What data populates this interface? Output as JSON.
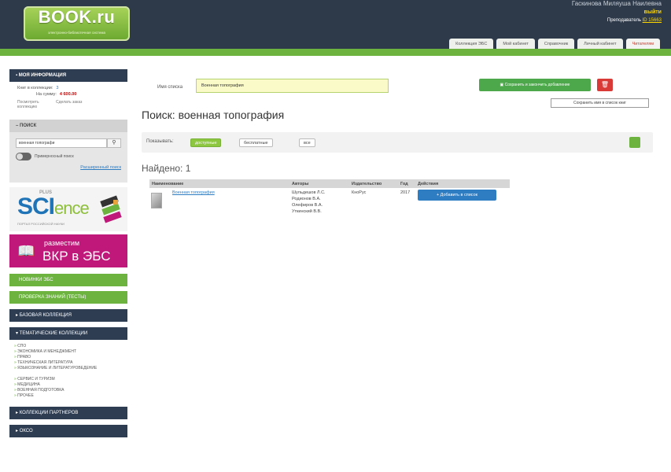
{
  "header": {
    "logo": "BOOK.ru",
    "logo_sub": "электронно-библиотечная система",
    "user_line": "Гаскинова Миляуша Наилевна",
    "login": "выйти",
    "teacher_label": "Преподаватель",
    "teacher_id": "ID 15663",
    "tabs": [
      "Коллекция ЭБС",
      "Мой кабинет",
      "Справочник",
      "Личный кабинет",
      "Читателям"
    ]
  },
  "sidebar": {
    "my_info_title": "МОЯ ИНФОРМАЦИЯ",
    "books_in_collection_label": "Книг в коллекции:",
    "books_in_collection_value": "3",
    "sum_label": "На сумму:",
    "sum_value": "4 600.00",
    "view_collection": "Посмотреть коллекцию",
    "make_order": "Сделать заказ",
    "search_title": "ПОИСК",
    "search_value": "военная топографи",
    "toggle_label": "Примерносный поиск",
    "extended_search": "Расширенный поиск",
    "science_word": "SCI",
    "science_rest": "ence",
    "science_plus": "PLUS",
    "science_caption": "ПОРТАЛ РОССИЙСКОЙ НАУКИ",
    "vkr_line1": "разместим",
    "vkr_line2": "ВКР в ЭБС",
    "new_ebs": "НОВИНКИ ЭБС",
    "knowledge_test": "ПРОВЕРКА ЗНАНИЙ (ТЕСТЫ)",
    "base_collection": "БАЗОВАЯ КОЛЛЕКЦИЯ",
    "thematic_collections": "ТЕМАТИЧЕСКИЕ КОЛЛЕКЦИИ",
    "categories": [
      "СПО",
      "ЭКОНОМИКА И МЕНЕДЖМЕНТ",
      "ПРАВО",
      "ТЕХНИЧЕСКАЯ ЛИТЕРАТУРА",
      "ЯЗЫКОЗНАНИЕ И ЛИТЕРАТУРОВЕДЕНИЕ",
      "СЕРВИС И ТУРИЗМ",
      "МЕДИЦИНА",
      "ВОЕННАЯ ПОДГОТОВКА",
      "ПРОЧЕЕ"
    ],
    "partner_collections": "КОЛЛЕКЦИИ ПАРТНЕРОВ",
    "okso": "ОКСО"
  },
  "main": {
    "list_label": "Имя списка",
    "list_value": "Военная топография",
    "save_add": "Сохранить и закончить добавление",
    "save_name": "Сохранить имя в список книг",
    "delete_icon": "trash-icon",
    "page_title": "Поиск: военная топография",
    "show_label": "Показывать:",
    "filter_available": "доступные",
    "filter_free": "бесплатные",
    "filter_all": "все",
    "found": "Найдено: 1",
    "columns": [
      "Наименование",
      "Авторы",
      "Издательство",
      "Год",
      "Действия"
    ],
    "rows": [
      {
        "title": "Военная топография",
        "authors": [
          "Шульдешов Л.С.",
          "Родионов В.А.",
          "Олефиров В.А.",
          "Уткинский В.В."
        ],
        "publisher": "КноРус",
        "year": "2017",
        "action": "+ Добавить в список"
      }
    ]
  },
  "colors": {
    "header": "#2e3a4a",
    "accent_green": "#6cb33f",
    "link_blue": "#2e7cc2",
    "magenta": "#c0187a",
    "danger_red": "#d93a37"
  }
}
